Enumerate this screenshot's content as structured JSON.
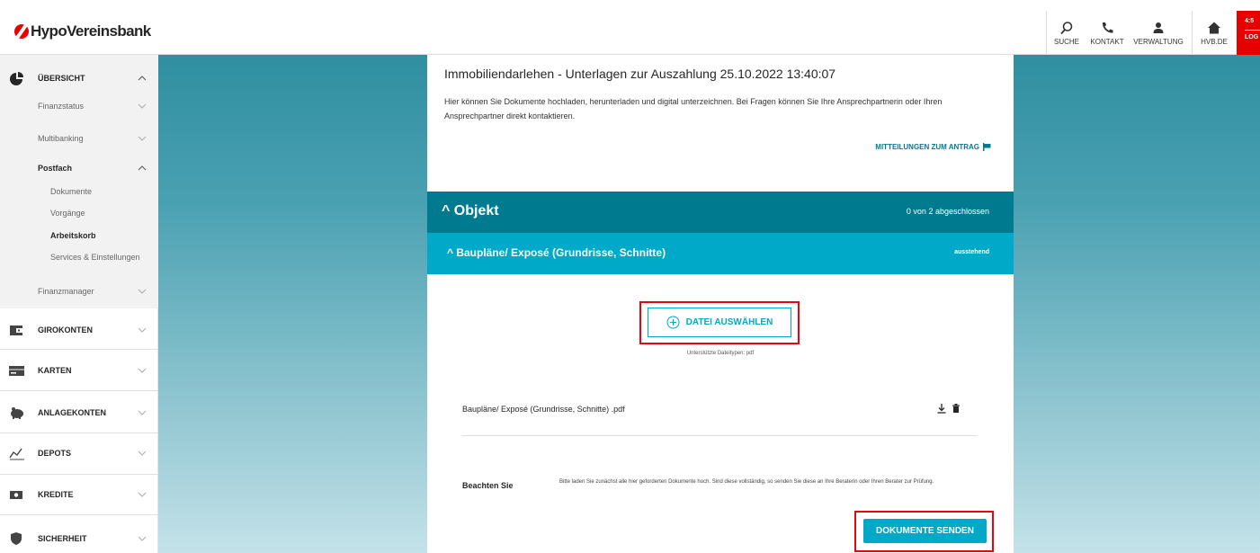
{
  "header": {
    "logo_text": "HypoVereinsbank",
    "nav": [
      {
        "label": "SUCHE",
        "icon": "search-icon"
      },
      {
        "label": "KONTAKT",
        "icon": "phone-icon"
      },
      {
        "label": "VERWALTUNG",
        "icon": "user-icon"
      },
      {
        "label": "HVB.DE",
        "icon": "home-icon"
      }
    ],
    "logout_time": "4:5",
    "logout_label": "LOG"
  },
  "sidebar": {
    "overview": {
      "label": "ÜBERSICHT",
      "icon": "pie-chart-icon"
    },
    "sub_items": {
      "finanzstatus": "Finanzstatus",
      "multibanking": "Multibanking",
      "postfach": "Postfach",
      "dokumente": "Dokumente",
      "vorgaenge": "Vorgänge",
      "arbeitskorb": "Arbeitskorb",
      "services": "Services & Einstellungen",
      "finanzmanager": "Finanzmanager"
    },
    "main_items": [
      {
        "label": "GIROKONTEN",
        "icon": "wallet-icon"
      },
      {
        "label": "KARTEN",
        "icon": "card-icon"
      },
      {
        "label": "ANLAGEKONTEN",
        "icon": "piggy-bank-icon"
      },
      {
        "label": "DEPOTS",
        "icon": "chart-line-icon"
      },
      {
        "label": "KREDITE",
        "icon": "banknote-icon"
      },
      {
        "label": "SICHERHEIT",
        "icon": "shield-icon"
      }
    ]
  },
  "main": {
    "title": "Immobiliendarlehen - Unterlagen zur Auszahlung 25.10.2022 13:40:07",
    "description": "Hier können Sie Dokumente hochladen, herunterladen und digital unterzeichnen. Bei Fragen können Sie Ihre Ansprechpartnerin oder Ihren Ansprechpartner direkt kontaktieren.",
    "messages_link": "MITTEILUNGEN ZUM ANTRAG",
    "object_section": {
      "title": "^ Objekt",
      "status": "0 von 2 abgeschlossen"
    },
    "sub_section": {
      "title": "^ Baupläne/ Exposé (Grundrisse, Schnitte)",
      "status": "ausstehend"
    },
    "upload_button": "DATEI AUSWÄHLEN",
    "supported_types": "Unterstützte Dateitypen: pdf",
    "file_name": "Baupläne/ Exposé (Grundrisse, Schnitte) .pdf",
    "note_label": "Beachten Sie",
    "note_text": "Bitte laden Sie zunächst alle hier geforderten Dokumente hoch. Sind diese vollständig, so senden Sie diese an Ihre Beraterin oder Ihren Berater zur Prüfung.",
    "send_button": "DOKUMENTE SENDEN"
  },
  "colors": {
    "brand_red": "#e60000",
    "teal_dark": "#007a8e",
    "teal_light": "#00a9c8",
    "highlight": "#e30613"
  }
}
